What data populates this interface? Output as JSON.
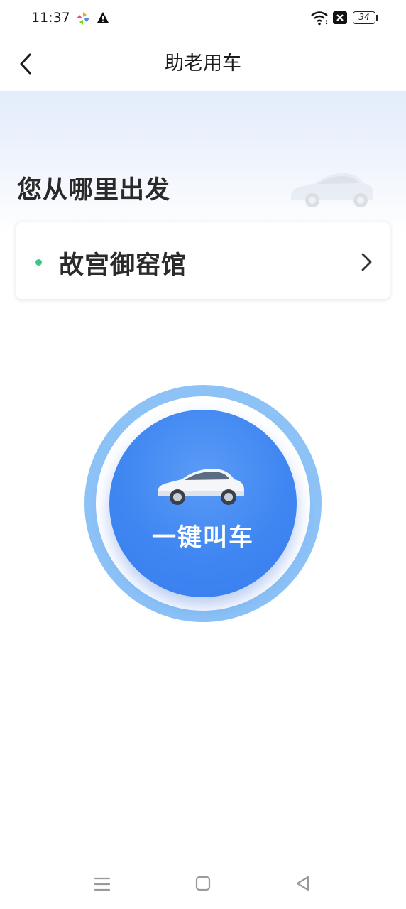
{
  "status_bar": {
    "time": "11:37",
    "battery": "34",
    "icons": [
      "app-icon",
      "warning-icon",
      "wifi-icon",
      "no-sim-icon",
      "battery-icon"
    ]
  },
  "header": {
    "title": "助老用车",
    "back_icon": "chevron-left-icon"
  },
  "hero": {
    "question": "您从哪里出发"
  },
  "origin": {
    "name": "故宫御窑馆",
    "dot_color": "#3ec48a"
  },
  "call_button": {
    "label": "一键叫车",
    "color": "#3f86f2",
    "ring_color": "#8cc2f6"
  },
  "nav_bar": {
    "icons": [
      "menu-icon",
      "home-icon",
      "back-triangle-icon"
    ]
  }
}
